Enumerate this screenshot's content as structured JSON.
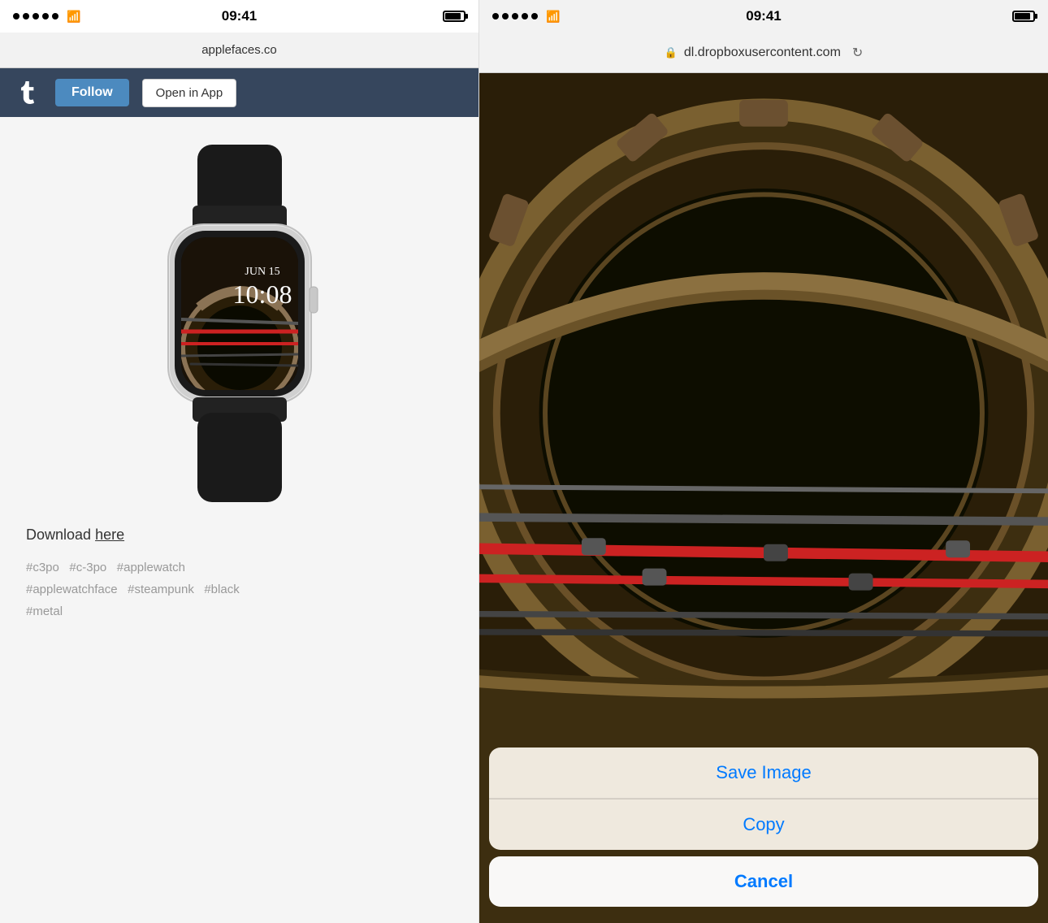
{
  "left": {
    "status_bar": {
      "time": "09:41",
      "url": "applefaces.co"
    },
    "header": {
      "follow_label": "Follow",
      "open_app_label": "Open in App"
    },
    "content": {
      "watch_date": "JUN 15",
      "watch_time": "10:08",
      "download_text": "Download ",
      "download_link": "here",
      "tags": "#c3po  #c-3po  #applewatch\n#applewatchface  #steampunk  #black\n#metal"
    }
  },
  "right": {
    "status_bar": {
      "time": "09:41",
      "url": "dl.dropboxusercontent.com"
    },
    "action_sheet": {
      "save_image": "Save Image",
      "copy": "Copy",
      "cancel": "Cancel"
    }
  }
}
